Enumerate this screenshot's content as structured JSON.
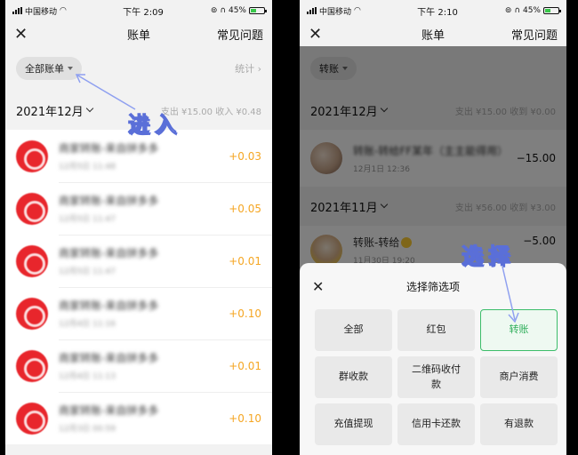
{
  "left": {
    "status": {
      "carrier": "中国移动",
      "time": "下午 2:09",
      "battery": "45%"
    },
    "nav": {
      "close": "✕",
      "title": "账单",
      "faq": "常见问题"
    },
    "filter": {
      "label": "全部账单",
      "stats": "统计 ›"
    },
    "month": {
      "label": "2021年12月",
      "summary": "支出 ¥15.00   收入 ¥0.48"
    },
    "annotation": "进入",
    "rows": [
      {
        "title": "商家转账-来自拼多多",
        "time": "12月5日 11:48",
        "amount": "+0.03"
      },
      {
        "title": "商家转账-来自拼多多",
        "time": "12月5日 11:47",
        "amount": "+0.05"
      },
      {
        "title": "商家转账-来自拼多多",
        "time": "12月5日 11:47",
        "amount": "+0.01"
      },
      {
        "title": "商家转账-来自拼多多",
        "time": "12月4日 11:16",
        "amount": "+0.10"
      },
      {
        "title": "商家转账-来自拼多多",
        "time": "12月4日 11:13",
        "amount": "+0.01"
      },
      {
        "title": "商家转账-来自拼多多",
        "time": "12月3日 00:59",
        "amount": "+0.10"
      }
    ]
  },
  "right": {
    "status": {
      "carrier": "中国移动",
      "time": "下午 2:10",
      "battery": "45%"
    },
    "nav": {
      "close": "✕",
      "title": "账单",
      "faq": "常见问题"
    },
    "filter": {
      "label": "转账"
    },
    "dec": {
      "label": "2021年12月",
      "summary": "支出 ¥15.00   收到 ¥0.00",
      "row": {
        "title": "转账-转给FF某年（主主能得用）",
        "time": "12月1日 12:36",
        "amount": "−15.00"
      }
    },
    "nov": {
      "label": "2021年11月",
      "summary": "支出 ¥56.00   收到 ¥3.00",
      "row": {
        "title": "转账-转给",
        "time": "11月30日 19:20",
        "amount": "−5.00"
      }
    },
    "annotation": "选择",
    "sheet": {
      "close": "✕",
      "title": "选择筛选项",
      "options": [
        "全部",
        "红包",
        "转账",
        "群收款",
        "二维码收付款",
        "商户消费",
        "充值提现",
        "信用卡还款",
        "有退款"
      ]
    }
  },
  "colors": {
    "accent_green": "#3cbd6a",
    "income_yellow": "#f5a623",
    "annotation_stroke": "#5a6fd8"
  }
}
